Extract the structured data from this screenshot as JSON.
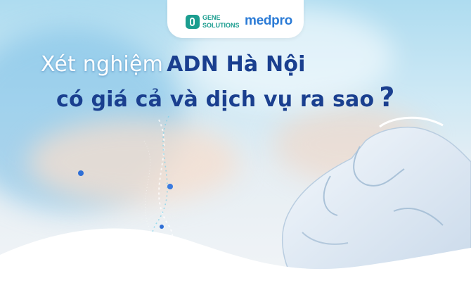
{
  "logo": {
    "gene_solutions_line1": "GENE",
    "gene_solutions_line2": "SOLUTIONS",
    "medpro": "medpro"
  },
  "headline": {
    "line1_light": "Xét nghiệm",
    "line1_strong": "ADN Hà Nội",
    "line2": "có giá cả và dịch vụ ra sao",
    "question_mark": "?"
  },
  "colors": {
    "gene_teal": "#1b9d8f",
    "medpro_blue": "#2b7bd6",
    "headline_navy": "#1a3f8f",
    "sky": "#aedcf0"
  },
  "icons": [
    "gene-solutions-logo-icon",
    "dna-helix-decoration",
    "gloved-hand-illustration"
  ]
}
